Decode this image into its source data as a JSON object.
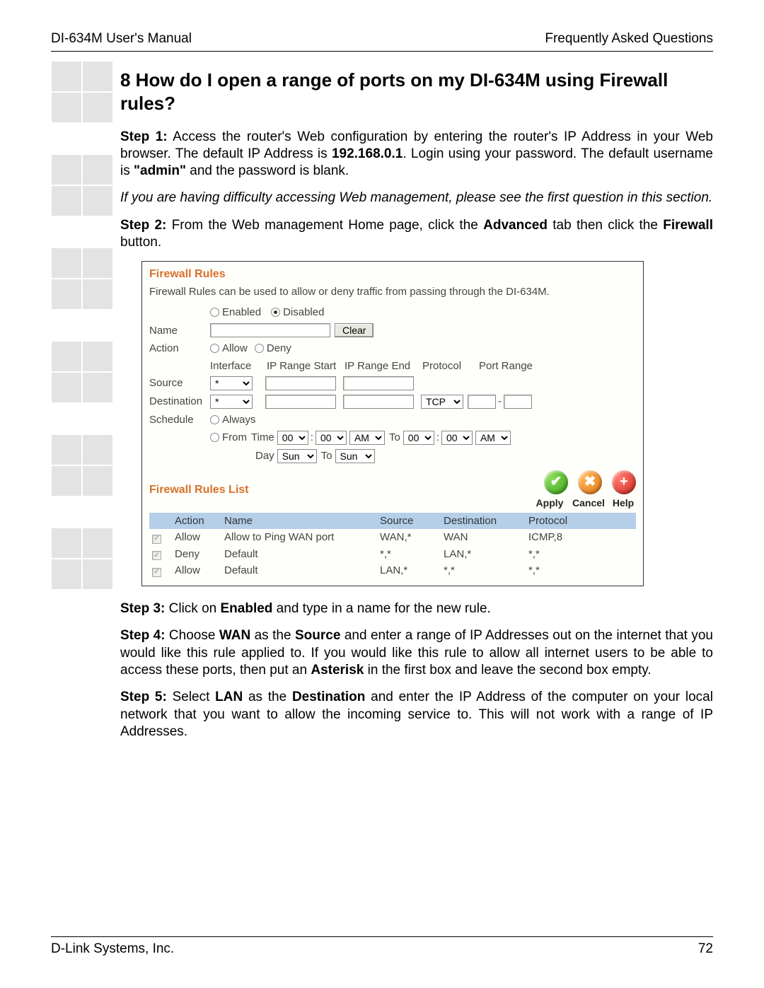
{
  "header": {
    "left": "DI-634M User's Manual",
    "right": "Frequently Asked Questions"
  },
  "title": "8 How do I open a range of ports on my DI-634M using Firewall rules?",
  "step1": {
    "label": "Step 1:",
    "t1": " Access the router's Web configuration by entering the router's IP Address in your Web browser. The default IP Address is ",
    "ip": "192.168.0.1",
    "t2": ". Login using your password. The default username is ",
    "admin": "\"admin\"",
    "t3": " and the password is blank."
  },
  "note": "If you are having difficulty accessing Web management, please see the first question in this section.",
  "step2": {
    "label": "Step 2:",
    "t1": " From the Web management Home page, click the ",
    "adv": "Advanced",
    "t2": " tab then click the ",
    "fw": "Firewall",
    "t3": " button."
  },
  "screenshot": {
    "title": "Firewall Rules",
    "desc": "Firewall Rules can be used to allow or deny traffic from passing through the DI-634M.",
    "enabled_label": "Enabled",
    "disabled_label": "Disabled",
    "name_label": "Name",
    "clear": "Clear",
    "action_label": "Action",
    "allow_label": "Allow",
    "deny_label": "Deny",
    "col_interface": "Interface",
    "col_ipstart": "IP Range Start",
    "col_ipend": "IP Range End",
    "col_protocol": "Protocol",
    "col_portrange": "Port Range",
    "source_label": "Source",
    "destination_label": "Destination",
    "src_sel": "*",
    "dst_sel": "*",
    "proto_sel": "TCP",
    "port_dash": "-",
    "schedule_label": "Schedule",
    "always_label": "Always",
    "from_label": "From",
    "time_label": "Time",
    "to_label": "To",
    "day_label": "Day",
    "t_h1": "00",
    "t_m1": "00",
    "t_ap1": "AM",
    "t_h2": "00",
    "t_m2": "00",
    "t_ap2": "AM",
    "day1": "Sun",
    "day2": "Sun",
    "apply": "Apply",
    "cancel": "Cancel",
    "help": "Help",
    "list_title": "Firewall Rules List",
    "list_headers": {
      "action": "Action",
      "name": "Name",
      "source": "Source",
      "dest": "Destination",
      "proto": "Protocol"
    },
    "rows": [
      {
        "action": "Allow",
        "name": "Allow to Ping WAN port",
        "source": "WAN,*",
        "dest": "WAN",
        "proto": "ICMP,8"
      },
      {
        "action": "Deny",
        "name": "Default",
        "source": "*,*",
        "dest": "LAN,*",
        "proto": "*,*"
      },
      {
        "action": "Allow",
        "name": "Default",
        "source": "LAN,*",
        "dest": "*,*",
        "proto": "*,*"
      }
    ]
  },
  "step3": {
    "label": "Step 3:",
    "t1": " Click on ",
    "en": "Enabled",
    "t2": " and type in a name for the new rule."
  },
  "step4": {
    "label": "Step 4:",
    "t1": " Choose ",
    "wan": "WAN",
    "t2": " as the ",
    "src": "Source",
    "t3": " and enter a range of IP Addresses out on the internet that you would like this rule applied to. If you would like this rule to allow all internet users to be able to access these ports, then put an ",
    "ast": "Asterisk",
    "t4": " in the first box and leave the second box empty."
  },
  "step5": {
    "label": "Step 5:",
    "t1": " Select ",
    "lan": "LAN",
    "t2": " as the ",
    "dst": "Destination",
    "t3": " and enter the IP Address of the computer on your local network that you want to allow the incoming service to. This will not work with a range of IP Addresses."
  },
  "footer": {
    "left": "D-Link Systems, Inc.",
    "right": "72"
  }
}
